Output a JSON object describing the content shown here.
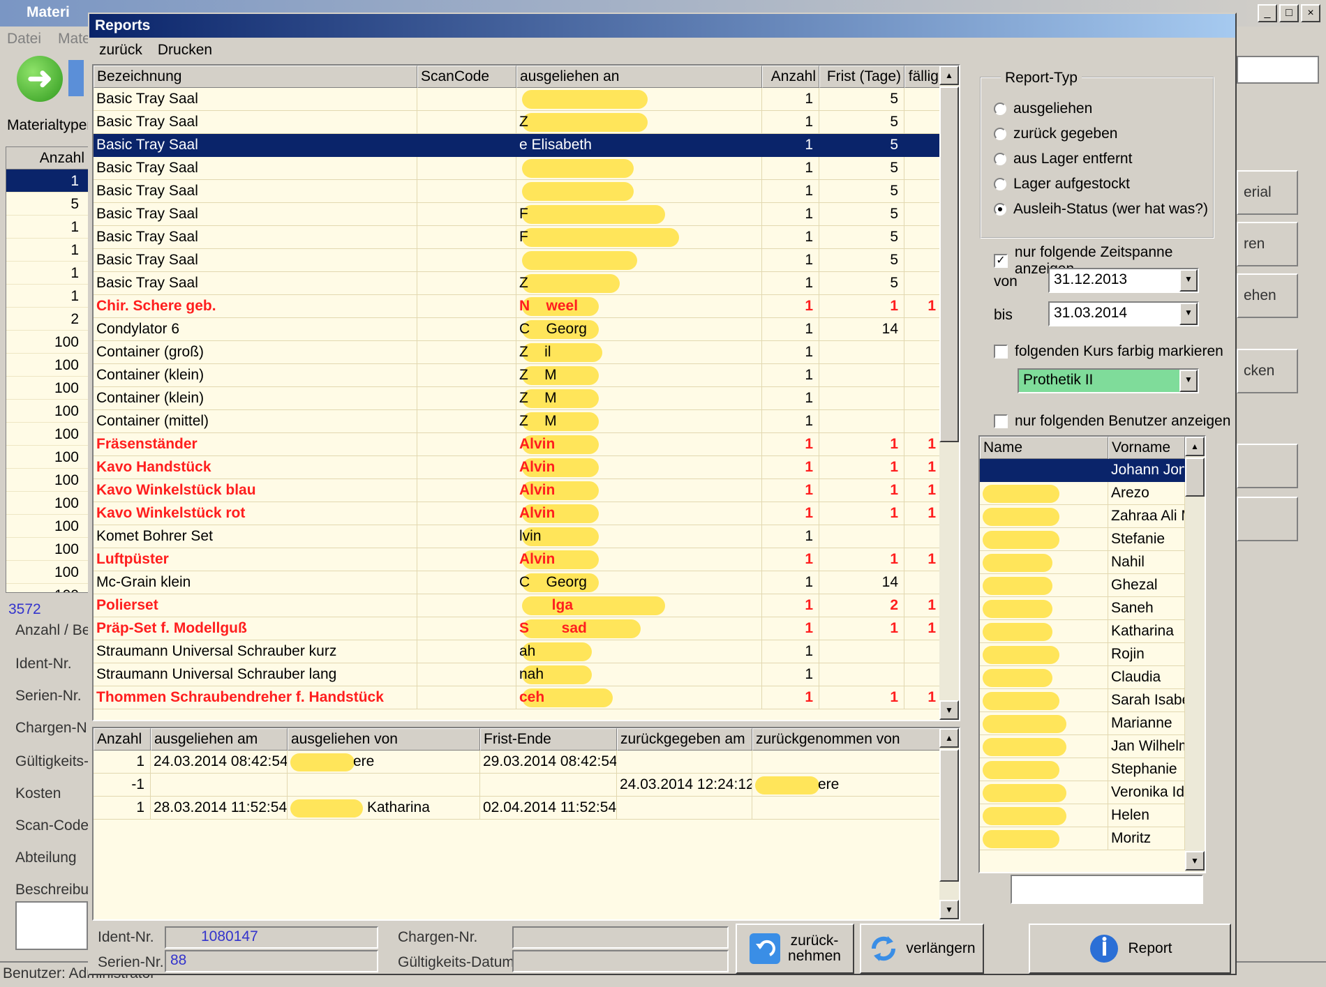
{
  "background_app": {
    "title": "Materi",
    "menu": [
      "Datei",
      "Mate"
    ],
    "materialtypen_label": "Materialtypen",
    "left_grid": {
      "header": "Anzahl",
      "values": [
        "1",
        "5",
        "1",
        "1",
        "1",
        "1",
        "2",
        "100",
        "100",
        "100",
        "100",
        "100",
        "100",
        "100",
        "100",
        "100",
        "100",
        "100",
        "100"
      ]
    },
    "count": "3572",
    "field_labels": [
      "Anzahl / Be",
      "Ident-Nr.",
      "Serien-Nr.",
      "Chargen-Nr.",
      "Gültigkeits-",
      "Kosten",
      "Scan-Code",
      "Abteilung",
      "Beschreibu"
    ],
    "status_text": "Benutzer: Administrator",
    "right_buttons": [
      "erial",
      "ren",
      "ehen",
      "cken",
      "",
      ""
    ],
    "window_controls": [
      "_",
      "□",
      "×"
    ]
  },
  "reports_window": {
    "title": "Reports",
    "menu": [
      "zurück",
      "Drucken"
    ],
    "main_grid": {
      "columns": [
        "Bezeichnung",
        "ScanCode",
        "ausgeliehen an",
        "Anzahl",
        "Frist (Tage)",
        "fällig"
      ],
      "rows": [
        {
          "bezeichnung": "Basic Tray Saal",
          "scancode": "",
          "ausgeliehen": "",
          "anzahl": "1",
          "frist": "5",
          "faellig": "",
          "red": false,
          "selected": false
        },
        {
          "bezeichnung": "Basic Tray Saal",
          "scancode": "",
          "ausgeliehen": "Z",
          "anzahl": "1",
          "frist": "5",
          "faellig": "",
          "red": false,
          "selected": false
        },
        {
          "bezeichnung": "Basic Tray Saal",
          "scancode": "",
          "ausgeliehen": "e Elisabeth",
          "anzahl": "1",
          "frist": "5",
          "faellig": "",
          "red": false,
          "selected": true
        },
        {
          "bezeichnung": "Basic Tray Saal",
          "scancode": "",
          "ausgeliehen": "",
          "anzahl": "1",
          "frist": "5",
          "faellig": "",
          "red": false,
          "selected": false
        },
        {
          "bezeichnung": "Basic Tray Saal",
          "scancode": "",
          "ausgeliehen": "",
          "anzahl": "1",
          "frist": "5",
          "faellig": "",
          "red": false,
          "selected": false
        },
        {
          "bezeichnung": "Basic Tray Saal",
          "scancode": "",
          "ausgeliehen": "F",
          "anzahl": "1",
          "frist": "5",
          "faellig": "",
          "red": false,
          "selected": false
        },
        {
          "bezeichnung": "Basic Tray Saal",
          "scancode": "",
          "ausgeliehen": "F",
          "anzahl": "1",
          "frist": "5",
          "faellig": "",
          "red": false,
          "selected": false
        },
        {
          "bezeichnung": "Basic Tray Saal",
          "scancode": "",
          "ausgeliehen": "",
          "anzahl": "1",
          "frist": "5",
          "faellig": "",
          "red": false,
          "selected": false
        },
        {
          "bezeichnung": "Basic Tray Saal",
          "scancode": "",
          "ausgeliehen": "Z",
          "anzahl": "1",
          "frist": "5",
          "faellig": "",
          "red": false,
          "selected": false
        },
        {
          "bezeichnung": "Chir. Schere geb.",
          "scancode": "",
          "ausgeliehen": "N    weel",
          "anzahl": "1",
          "frist": "1",
          "faellig": "1",
          "red": true,
          "selected": false
        },
        {
          "bezeichnung": "Condylator 6",
          "scancode": "",
          "ausgeliehen": "C    Georg",
          "anzahl": "1",
          "frist": "14",
          "faellig": "",
          "red": false,
          "selected": false
        },
        {
          "bezeichnung": "Container (groß)",
          "scancode": "",
          "ausgeliehen": "Z    il",
          "anzahl": "1",
          "frist": "",
          "faellig": "",
          "red": false,
          "selected": false
        },
        {
          "bezeichnung": "Container (klein)",
          "scancode": "",
          "ausgeliehen": "Z    M",
          "anzahl": "1",
          "frist": "",
          "faellig": "",
          "red": false,
          "selected": false
        },
        {
          "bezeichnung": "Container (klein)",
          "scancode": "",
          "ausgeliehen": "Z    M",
          "anzahl": "1",
          "frist": "",
          "faellig": "",
          "red": false,
          "selected": false
        },
        {
          "bezeichnung": "Container (mittel)",
          "scancode": "",
          "ausgeliehen": "Z    M",
          "anzahl": "1",
          "frist": "",
          "faellig": "",
          "red": false,
          "selected": false
        },
        {
          "bezeichnung": "Fräsenständer",
          "scancode": "",
          "ausgeliehen": "Alvin",
          "anzahl": "1",
          "frist": "1",
          "faellig": "1",
          "red": true,
          "selected": false
        },
        {
          "bezeichnung": "Kavo Handstück",
          "scancode": "",
          "ausgeliehen": "Alvin",
          "anzahl": "1",
          "frist": "1",
          "faellig": "1",
          "red": true,
          "selected": false
        },
        {
          "bezeichnung": "Kavo Winkelstück blau",
          "scancode": "",
          "ausgeliehen": "Alvin",
          "anzahl": "1",
          "frist": "1",
          "faellig": "1",
          "red": true,
          "selected": false
        },
        {
          "bezeichnung": "Kavo Winkelstück rot",
          "scancode": "",
          "ausgeliehen": "Alvin",
          "anzahl": "1",
          "frist": "1",
          "faellig": "1",
          "red": true,
          "selected": false
        },
        {
          "bezeichnung": "Komet Bohrer Set",
          "scancode": "",
          "ausgeliehen": "lvin",
          "anzahl": "1",
          "frist": "",
          "faellig": "",
          "red": false,
          "selected": false
        },
        {
          "bezeichnung": "Luftpüster",
          "scancode": "",
          "ausgeliehen": "Alvin",
          "anzahl": "1",
          "frist": "1",
          "faellig": "1",
          "red": true,
          "selected": false
        },
        {
          "bezeichnung": "Mc-Grain klein",
          "scancode": "",
          "ausgeliehen": "C    Georg",
          "anzahl": "1",
          "frist": "14",
          "faellig": "",
          "red": false,
          "selected": false
        },
        {
          "bezeichnung": "Polierset",
          "scancode": "",
          "ausgeliehen": "        lga",
          "anzahl": "1",
          "frist": "2",
          "faellig": "1",
          "red": true,
          "selected": false
        },
        {
          "bezeichnung": "Präp-Set f. Modellguß",
          "scancode": "",
          "ausgeliehen": "S        sad",
          "anzahl": "1",
          "frist": "1",
          "faellig": "1",
          "red": true,
          "selected": false
        },
        {
          "bezeichnung": "Straumann Universal Schrauber kurz",
          "scancode": "",
          "ausgeliehen": "ah",
          "anzahl": "1",
          "frist": "",
          "faellig": "",
          "red": false,
          "selected": false
        },
        {
          "bezeichnung": "Straumann Universal Schrauber lang",
          "scancode": "",
          "ausgeliehen": "nah",
          "anzahl": "1",
          "frist": "",
          "faellig": "",
          "red": false,
          "selected": false
        },
        {
          "bezeichnung": "Thommen Schraubendreher f. Handstück",
          "scancode": "",
          "ausgeliehen": "ceh",
          "anzahl": "1",
          "frist": "1",
          "faellig": "1",
          "red": true,
          "selected": false
        }
      ]
    },
    "detail_grid": {
      "columns": [
        "Anzahl",
        "ausgeliehen am",
        "ausgeliehen von",
        "Frist-Ende",
        "zurückgegeben am",
        "zurückgenommen von"
      ],
      "rows": [
        {
          "anzahl": "1",
          "am": "24.03.2014 08:42:54",
          "von": "ere",
          "frist_ende": "29.03.2014 08:42:54",
          "zurueck_am": "",
          "zurueck_von": ""
        },
        {
          "anzahl": "-1",
          "am": "",
          "von": "",
          "frist_ende": "",
          "zurueck_am": "24.03.2014 12:24:12",
          "zurueck_von": "ere"
        },
        {
          "anzahl": "1",
          "am": "28.03.2014 11:52:54",
          "von": "Katharina",
          "frist_ende": "02.04.2014 11:52:54",
          "zurueck_am": "",
          "zurueck_von": ""
        }
      ]
    },
    "bottom": {
      "ident_label": "Ident-Nr.",
      "ident_value": "1080147",
      "serien_label": "Serien-Nr.",
      "serien_value": "88",
      "chargen_label": "Chargen-Nr.",
      "chargen_value": "",
      "gueltig_label": "Gültigkeits-Datum",
      "gueltig_value": "",
      "zuruecknehmen_line1": "zurück-",
      "zuruecknehmen_line2": "nehmen",
      "verlaengern": "verlängern",
      "report": "Report"
    },
    "report_typ": {
      "legend": "Report-Typ",
      "options": [
        "ausgeliehen",
        "zurück gegeben",
        "aus Lager entfernt",
        "Lager aufgestockt",
        "Ausleih-Status (wer hat was?)"
      ],
      "selected_index": 4
    },
    "zeitspanne": {
      "label": "nur folgende Zeitspanne anzeigen",
      "checked": true,
      "von_label": "von",
      "von_value": "31.12.2013",
      "bis_label": "bis",
      "bis_value": "31.03.2014"
    },
    "kurs": {
      "label": "folgenden Kurs farbig markieren",
      "checked": false,
      "value": "Prothetik II"
    },
    "benutzer": {
      "label": "nur folgenden Benutzer anzeigen",
      "checked": false,
      "columns": [
        "Name",
        "Vorname"
      ],
      "rows": [
        "Johann Jonj",
        "Arezo",
        "Zahraa Ali Ma",
        "Stefanie",
        "Nahil",
        "Ghezal",
        "Saneh",
        "Katharina",
        "Rojin",
        "Claudia",
        "Sarah Isabell",
        "Marianne",
        "Jan Wilhelm",
        "Stephanie",
        "Veronika Ida",
        "Helen",
        "Moritz"
      ],
      "selected_index": 0,
      "filter_value": ""
    }
  },
  "colors": {
    "grid_bg": "#fffbe6",
    "selection": "#0a246a",
    "overdue_red": "#ff1e1e",
    "redaction_yellow": "#ffe24a",
    "kurs_green": "#7fdc9a"
  }
}
